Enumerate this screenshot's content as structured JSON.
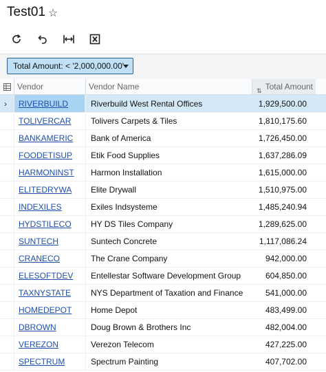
{
  "window": {
    "title": "Test01"
  },
  "toolbar": {
    "buttons": [
      {
        "name": "refresh-icon",
        "symbol": "refresh"
      },
      {
        "name": "undo-icon",
        "symbol": "undo"
      },
      {
        "name": "fit-columns-icon",
        "symbol": "fit-columns"
      },
      {
        "name": "excel-export-icon",
        "symbol": "excel"
      }
    ]
  },
  "filter": {
    "label": "Total Amount: < '2,000,000.00'"
  },
  "grid": {
    "columns": {
      "vendor": "Vendor",
      "vendor_name": "Vendor Name",
      "total_amount": "Total Amount"
    },
    "rows": [
      {
        "vendor": "RIVERBUILD",
        "name": "Riverbuild West Rental Offices",
        "amount": "1,929,500.00"
      },
      {
        "vendor": "TOLIVERCAR",
        "name": "Tolivers Carpets & Tiles",
        "amount": "1,810,175.60"
      },
      {
        "vendor": "BANKAMERIC",
        "name": "Bank of America",
        "amount": "1,726,450.00"
      },
      {
        "vendor": "FOODETISUP",
        "name": "Etik Food Supplies",
        "amount": "1,637,286.09"
      },
      {
        "vendor": "HARMONINST",
        "name": "Harmon Installation",
        "amount": "1,615,000.00"
      },
      {
        "vendor": "ELITEDRYWA",
        "name": "Elite Drywall",
        "amount": "1,510,975.00"
      },
      {
        "vendor": "INDEXILES",
        "name": "Exiles Indsysteme",
        "amount": "1,485,240.94"
      },
      {
        "vendor": "HYDSTILECO",
        "name": "HY DS Tiles Company",
        "amount": "1,289,625.00"
      },
      {
        "vendor": "SUNTECH",
        "name": "Suntech Concrete",
        "amount": "1,117,086.24"
      },
      {
        "vendor": "CRANECO",
        "name": "The Crane Company",
        "amount": "942,000.00"
      },
      {
        "vendor": "ELESOFTDEV",
        "name": "Entellestar Software Development Group",
        "amount": "604,850.00"
      },
      {
        "vendor": "TAXNYSTATE",
        "name": "NYS Department of Taxation and Finance",
        "amount": "541,000.00"
      },
      {
        "vendor": "HOMEDEPOT",
        "name": "Home Depot",
        "amount": "483,499.00"
      },
      {
        "vendor": "DBROWN",
        "name": "Doug Brown & Brothers Inc",
        "amount": "482,004.00"
      },
      {
        "vendor": "VEREZON",
        "name": "Verezon Telecom",
        "amount": "427,225.00"
      },
      {
        "vendor": "SPECTRUM",
        "name": "Spectrum Painting",
        "amount": "407,702.00"
      }
    ]
  }
}
